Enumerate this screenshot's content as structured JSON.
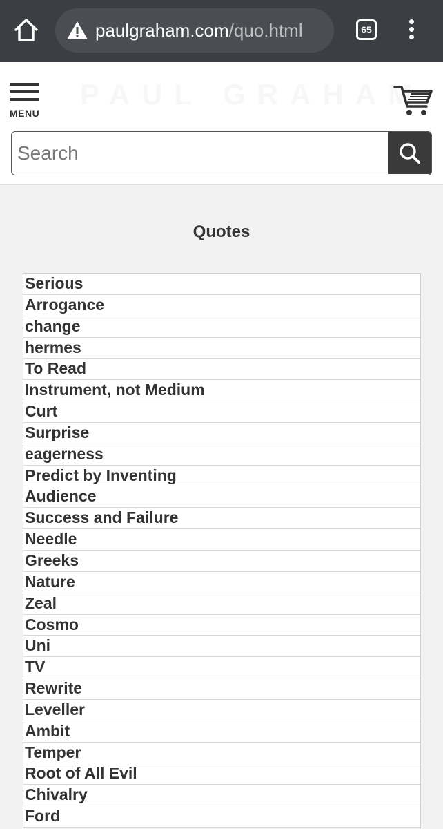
{
  "browser": {
    "url_host": "paulgraham.com",
    "url_path": "/quo.html",
    "tab_count": "65",
    "icons": [
      "home-icon",
      "warning-icon",
      "tabs-icon",
      "more-vert-icon"
    ]
  },
  "header": {
    "menu_label": "MENU",
    "logo_text": "PAUL GRAHAM",
    "cart_icon": "cart-icon"
  },
  "search": {
    "placeholder": "Search",
    "value": "",
    "icon": "search-icon"
  },
  "main": {
    "title": "Quotes",
    "quotes": [
      "Serious",
      "Arrogance",
      "change",
      "hermes",
      "To Read",
      "Instrument, not Medium",
      "Curt",
      "Surprise",
      "eagerness",
      "Predict by Inventing",
      "Audience",
      "Success and Failure",
      "Needle",
      "Greeks",
      "Nature",
      "Zeal",
      "Cosmo",
      "Uni",
      "TV",
      "Rewrite",
      "Leveller",
      "Ambit",
      "Temper",
      "Root of All Evil",
      "Chivalry",
      "Ford"
    ]
  },
  "colors": {
    "chrome_bg": "#3b3f43",
    "page_bg": "#f2f2f2",
    "text": "#333333",
    "search_button_bg": "#3a3a3a"
  }
}
